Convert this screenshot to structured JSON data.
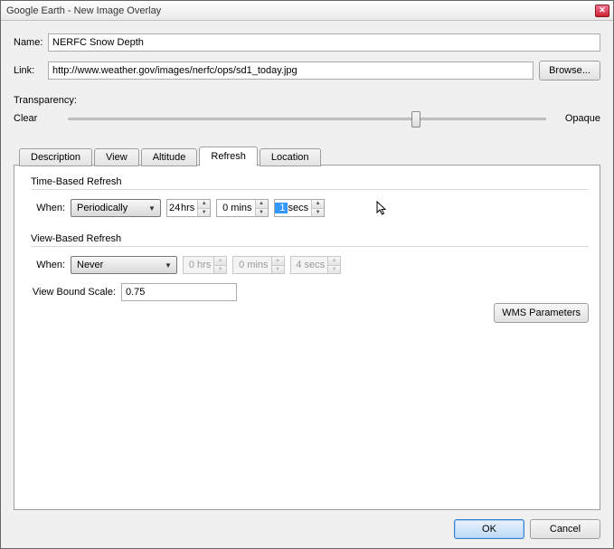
{
  "window": {
    "title": "Google Earth - New Image Overlay"
  },
  "name": {
    "label": "Name:",
    "value": "NERFC Snow Depth"
  },
  "link": {
    "label": "Link:",
    "value": "http://www.weather.gov/images/nerfc/ops/sd1_today.jpg",
    "browse": "Browse..."
  },
  "transparency": {
    "label": "Transparency:",
    "left": "Clear",
    "right": "Opaque"
  },
  "tabs": {
    "description": "Description",
    "view": "View",
    "altitude": "Altitude",
    "refresh": "Refresh",
    "location": "Location"
  },
  "refresh": {
    "time_section": "Time-Based Refresh",
    "view_section": "View-Based Refresh",
    "when_label": "When:",
    "periodically": "Periodically",
    "never": "Never",
    "t_hrs_val": "24",
    "t_hrs_unit": "hrs",
    "t_mins_val": "0",
    "t_mins_unit": "mins",
    "t_secs_val": "1",
    "t_secs_unit": "secs",
    "v_hrs_val": "0",
    "v_hrs_unit": "hrs",
    "v_mins_val": "0",
    "v_mins_unit": "mins",
    "v_secs_val": "4",
    "v_secs_unit": "secs",
    "view_bound_label": "View Bound Scale:",
    "view_bound_value": "0.75",
    "wms": "WMS Parameters"
  },
  "footer": {
    "ok": "OK",
    "cancel": "Cancel"
  }
}
